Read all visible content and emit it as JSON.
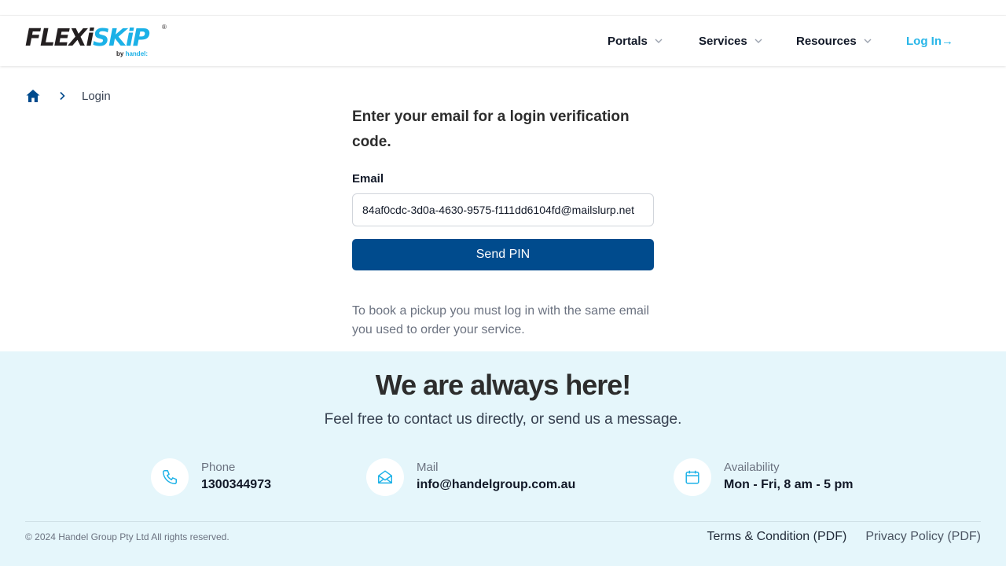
{
  "brand": {
    "logo_flexi": "FLEXi",
    "logo_skip": "SKiP",
    "logo_reg": "®",
    "logo_by": "by",
    "logo_handel": "handel:"
  },
  "nav": {
    "items": [
      {
        "label": "Portals",
        "icon": "chevron-down-icon"
      },
      {
        "label": "Services",
        "icon": "chevron-down-icon"
      },
      {
        "label": "Resources",
        "icon": "chevron-down-icon"
      }
    ],
    "login_label": "Log In→"
  },
  "breadcrumb": {
    "home_icon": "home-icon",
    "separator_icon": "chevron-right-icon",
    "current": "Login"
  },
  "login": {
    "heading": "Enter your email for a login verification code.",
    "email_label": "Email",
    "email_value": "84af0cdc-3d0a-4630-9575-f111dd6104fd@mailslurp.net",
    "send_label": "Send PIN",
    "note": "To book a pickup you must log in with the same email you used to order your service."
  },
  "footer": {
    "title": "We are always here!",
    "subtitle": "Feel free to contact us directly, or send us a message.",
    "contacts": [
      {
        "label": "Phone",
        "value": "1300344973",
        "icon": "phone-icon"
      },
      {
        "label": "Mail",
        "value": "info@handelgroup.com.au",
        "icon": "mail-open-icon"
      },
      {
        "label": "Availability",
        "value": "Mon - Fri, 8 am - 5 pm",
        "icon": "calendar-icon"
      }
    ],
    "copyright": "© 2024 Handel Group Pty Ltd All rights reserved.",
    "terms_label": "Terms & Condition (PDF)",
    "privacy_label": "Privacy Policy (PDF)"
  },
  "colors": {
    "primary": "#004b8d",
    "accent": "#29b6e8",
    "footer_bg": "#e5f6fb",
    "icon_accent": "#1bb1e7"
  }
}
